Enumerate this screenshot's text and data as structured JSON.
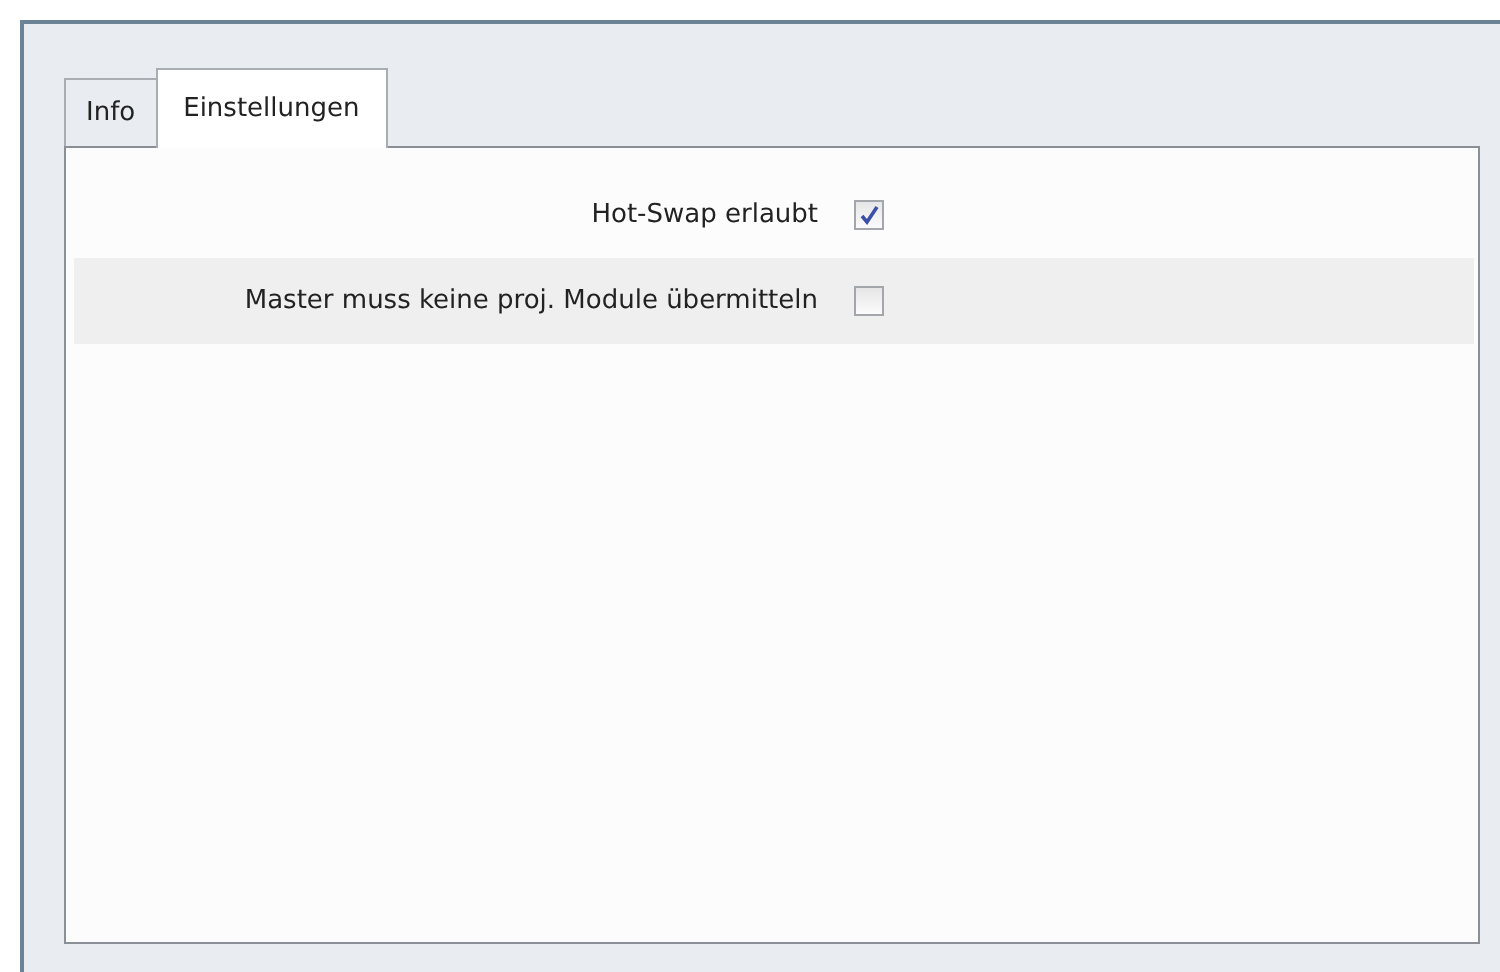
{
  "tabs": [
    {
      "label": "Info",
      "selected": false
    },
    {
      "label": "Einstellungen",
      "selected": true
    }
  ],
  "settings": [
    {
      "label": "Hot-Swap erlaubt",
      "checked": true,
      "highlighted": false
    },
    {
      "label": "Master muss keine proj. Module übermitteln",
      "checked": false,
      "highlighted": true
    }
  ]
}
